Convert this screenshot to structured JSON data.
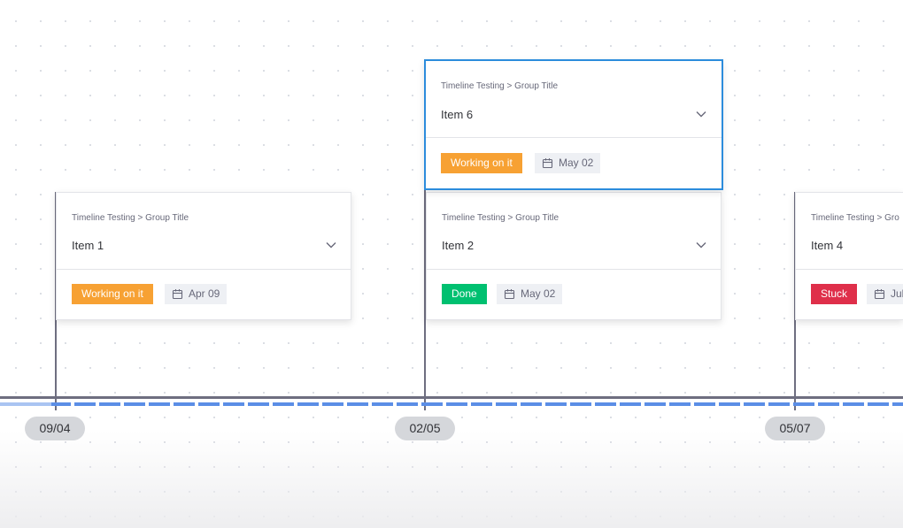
{
  "colors": {
    "working": "#f7a133",
    "done": "#00c070",
    "stuck": "#df2f4a",
    "selected_border": "#2c8cdc",
    "axis_dash": "#5b8ee6"
  },
  "axis": {
    "dates": [
      "09/04",
      "02/05",
      "05/07"
    ]
  },
  "cards": [
    {
      "breadcrumb": "Timeline Testing > Group Title",
      "title": "Item 6",
      "status": "Working on it",
      "date": "May 02",
      "selected": true,
      "icon": "chevron-down-icon",
      "date_icon": "calendar-icon"
    },
    {
      "breadcrumb": "Timeline Testing > Group Title",
      "title": "Item 1",
      "status": "Working on it",
      "date": "Apr 09",
      "icon": "chevron-down-icon",
      "date_icon": "calendar-icon"
    },
    {
      "breadcrumb": "Timeline Testing > Group Title",
      "title": "Item 2",
      "status": "Done",
      "date": "May 02",
      "icon": "chevron-down-icon",
      "date_icon": "calendar-icon"
    },
    {
      "breadcrumb": "Timeline Testing > Gro",
      "title": "Item 4",
      "status": "Stuck",
      "date": "Jul",
      "icon": "chevron-down-icon",
      "date_icon": "calendar-icon"
    }
  ]
}
